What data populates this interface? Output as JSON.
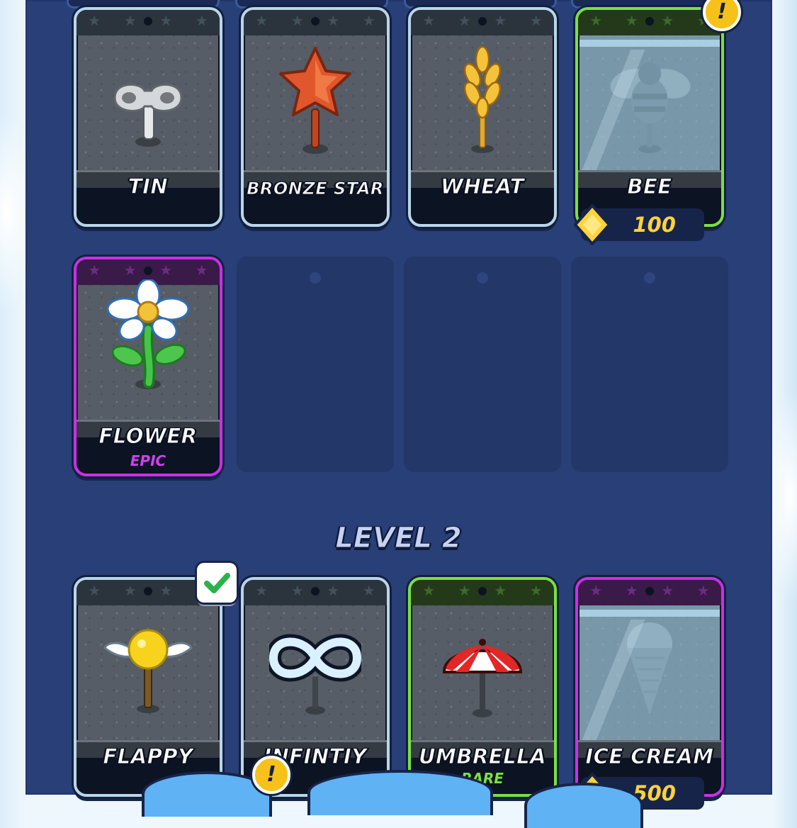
{
  "level2": {
    "title": "LEVEL 2"
  },
  "row1": [
    {
      "name": "TIN",
      "rarity": "",
      "icon": "tin-key-icon"
    },
    {
      "name": "BRONZE STAR",
      "rarity": "",
      "icon": "bronze-star-icon"
    },
    {
      "name": "WHEAT",
      "rarity": "",
      "icon": "wheat-icon"
    },
    {
      "name": "BEE",
      "rarity": "",
      "icon": "bee-icon",
      "locked": true,
      "price": "100"
    }
  ],
  "row2": [
    {
      "name": "FLOWER",
      "rarity": "EPIC",
      "icon": "flower-icon"
    }
  ],
  "row3": [
    {
      "name": "FLAPPY",
      "rarity": "",
      "icon": "flappy-ball-icon",
      "selected": true
    },
    {
      "name": "INFINTIY",
      "rarity": "",
      "icon": "infinity-icon"
    },
    {
      "name": "UMBRELLA",
      "rarity": "RARE",
      "icon": "umbrella-icon"
    },
    {
      "name": "ICE CREAM",
      "rarity": "",
      "icon": "ice-cream-icon",
      "locked": true,
      "price": "500"
    }
  ],
  "badges": {
    "alert": "!"
  },
  "colors": {
    "panel": "#283f78",
    "common_border": "#b9d6ea",
    "rare": "#7be043",
    "epic": "#c930e6",
    "coin": "#ffd23a"
  }
}
